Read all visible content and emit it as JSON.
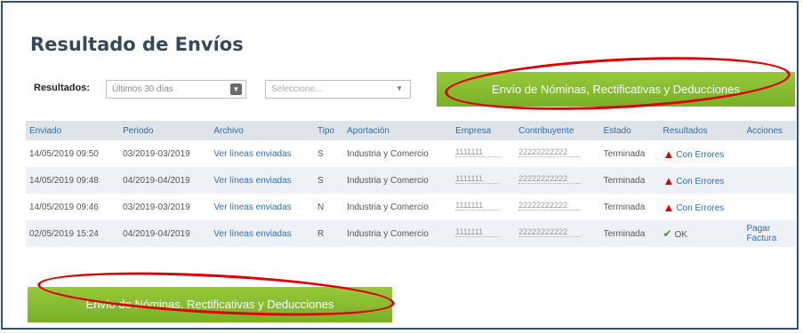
{
  "page": {
    "title": "Resultado de Envíos"
  },
  "filters": {
    "resultados_label": "Resultados:",
    "resultados_value": "Últimos 30 días",
    "second_placeholder": "Seleccione..."
  },
  "buttons": {
    "envio_top": "Envío de Nóminas, Rectificativas y Deducciones",
    "envio_bottom": "Envío de Nóminas, Rectificativas y Deducciones"
  },
  "table": {
    "headers": [
      "Enviado",
      "Periodo",
      "Archivo",
      "Tipo",
      "Aportación",
      "Empresa",
      "Contribuyente",
      "Estado",
      "Resultados",
      "Acciones"
    ],
    "rows": [
      {
        "enviado": "14/05/2019 09:50",
        "periodo": "03/2019-03/2019",
        "archivo": "Ver líneas enviadas",
        "tipo": "S",
        "aportacion": "Industria y Comercio",
        "empresa": "1111111",
        "contribuyente": "22222222222",
        "estado": "Terminada",
        "resultados": "Con Errores",
        "acciones": ""
      },
      {
        "enviado": "14/05/2019 09:48",
        "periodo": "04/2019-04/2019",
        "archivo": "Ver líneas enviadas",
        "tipo": "S",
        "aportacion": "Industria y Comercio",
        "empresa": "1111111",
        "contribuyente": "22222222222",
        "estado": "Terminada",
        "resultados": "Con Errores",
        "acciones": ""
      },
      {
        "enviado": "14/05/2019 09:46",
        "periodo": "03/2019-03/2019",
        "archivo": "Ver líneas enviadas",
        "tipo": "N",
        "aportacion": "Industria y Comercio",
        "empresa": "1111111",
        "contribuyente": "22222222222",
        "estado": "Terminada",
        "resultados": "Con Errores",
        "acciones": ""
      },
      {
        "enviado": "02/05/2019 15:24",
        "periodo": "04/2019-04/2019",
        "archivo": "Ver líneas enviadas",
        "tipo": "R",
        "aportacion": "Industria y Comercio",
        "empresa": "1111111",
        "contribuyente": "22222222222",
        "estado": "Terminada",
        "resultados": "OK",
        "acciones": "Pagar Factura"
      }
    ]
  },
  "icons": {
    "error": "warning-triangle-icon",
    "ok": "check-icon"
  },
  "colors": {
    "accent_green": "#84bd2e",
    "link_blue": "#2a6ebb",
    "highlight_red": "#e00000",
    "error_red": "#d00000"
  }
}
